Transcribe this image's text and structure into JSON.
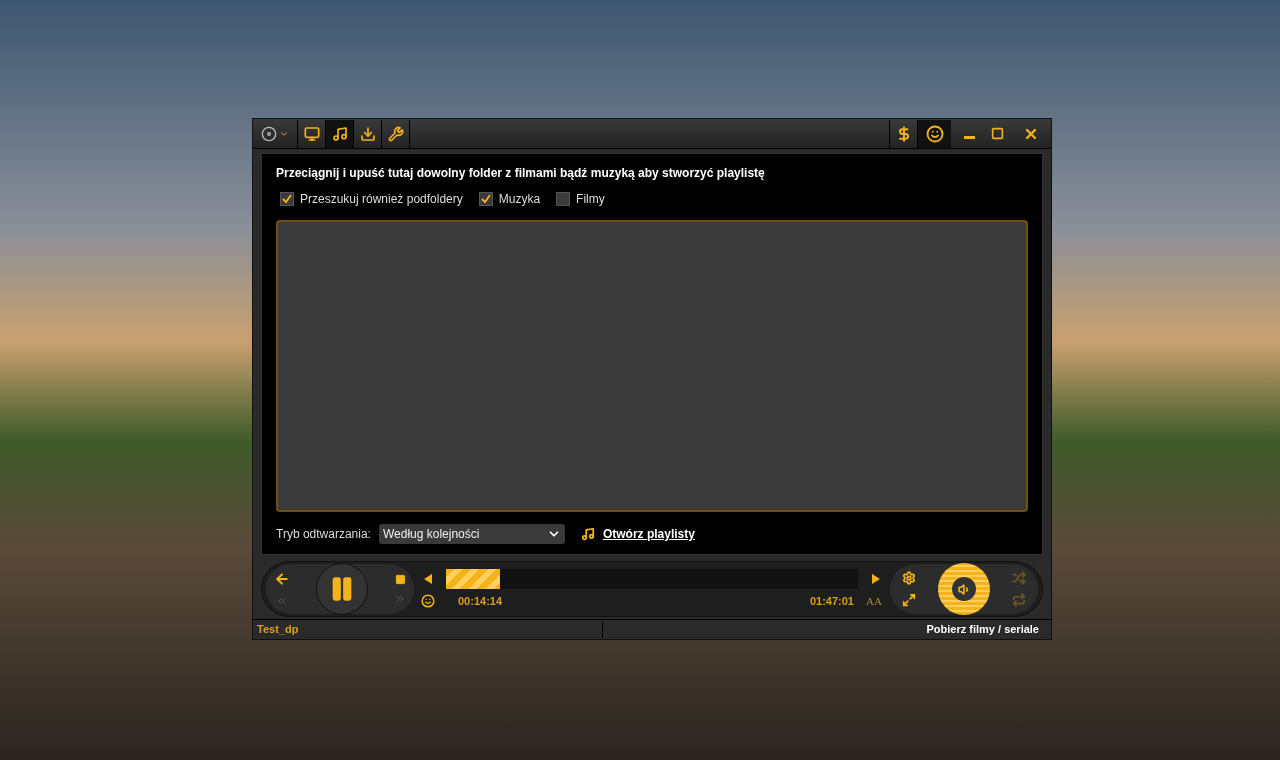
{
  "toolbar": {
    "tabs": [
      {
        "selected": false
      },
      {
        "selected": true
      },
      {
        "selected": false
      },
      {
        "selected": false
      }
    ]
  },
  "playlist_panel": {
    "instruction": "Przeciągnij i upuść tutaj dowolny folder z filmami bądź muzyką aby stworzyć playlistę",
    "options": [
      {
        "label": "Przeszukuj również podfoldery",
        "checked": true
      },
      {
        "label": "Muzyka",
        "checked": true
      },
      {
        "label": "Filmy",
        "checked": false
      }
    ],
    "playback_mode": {
      "label": "Tryb odtwarzania:",
      "value": "Według kolejności"
    },
    "open_link": "Otwórz playlisty"
  },
  "player": {
    "playing": true,
    "progress": {
      "level": 0.13
    },
    "elapsed": "00:14:14",
    "total": "01:47:01",
    "subtitle_button": "AA"
  },
  "status_bar": {
    "left": "Test_dp",
    "right": "Pobierz filmy / seriale"
  }
}
